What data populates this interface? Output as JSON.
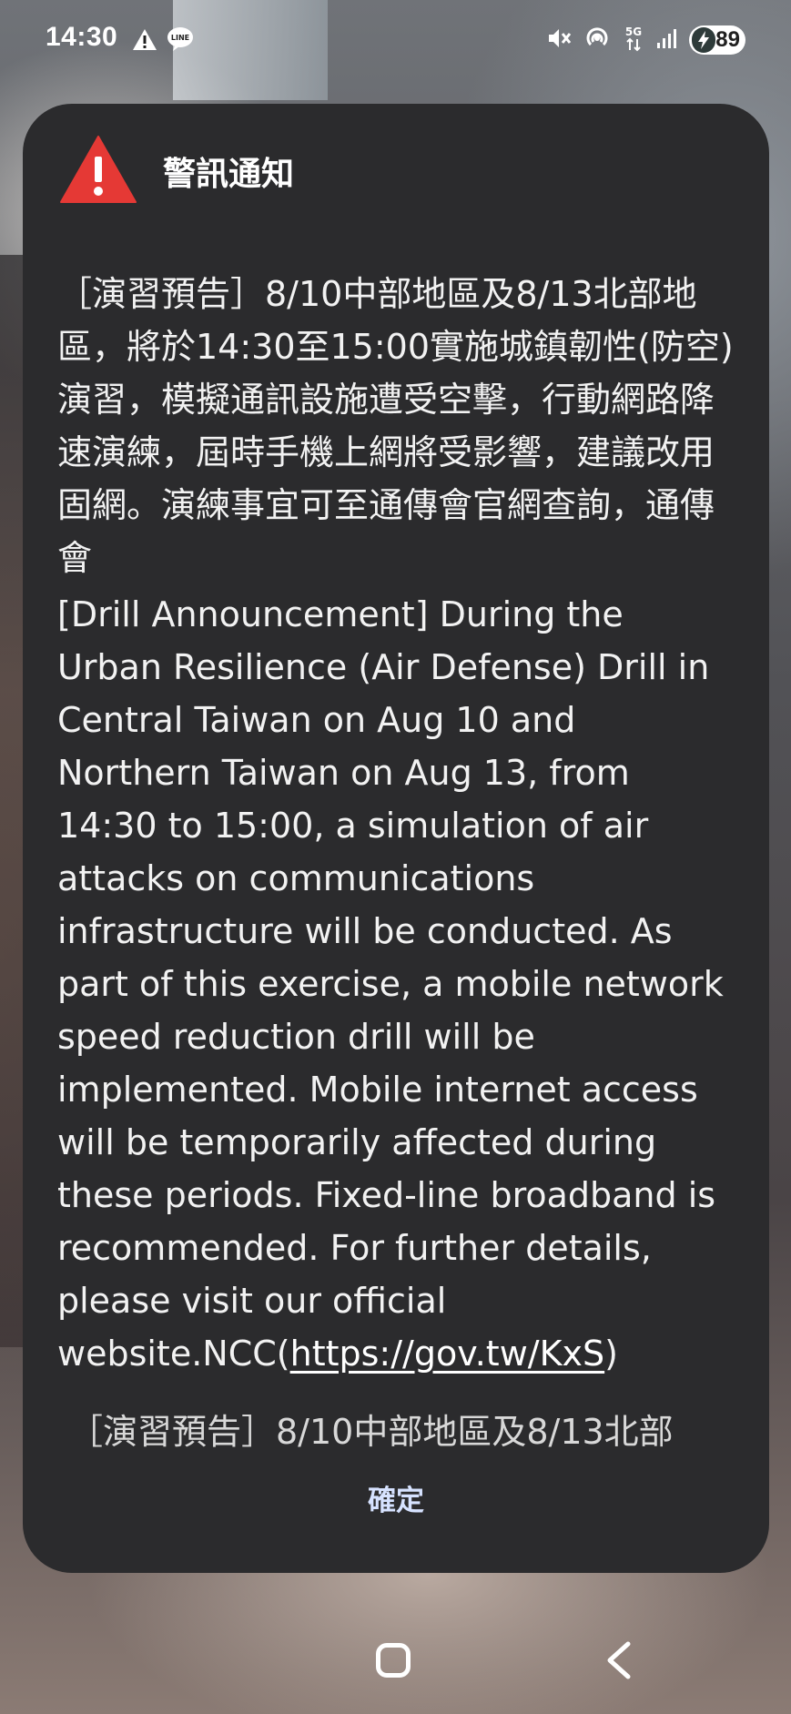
{
  "status_bar": {
    "time": "14:30",
    "left_icons": [
      "warning-icon",
      "line-app-icon"
    ],
    "right_icons": [
      "mute-vibrate-icon",
      "hotspot-icon",
      "5g-icon",
      "signal-icon"
    ],
    "network_label": "5G",
    "battery": "89"
  },
  "dialog": {
    "title": "警訊通知",
    "zh_message": "［演習預告］8/10中部地區及8/13北部地區，將於14:30至15:00實施城鎮韌性(防空)演習，模擬通訊設施遭受空擊，行動網路降速演練，屆時手機上網將受影響，建議改用固網。演練事宜可至通傳會官網查詢，通傳會",
    "en_message": "[Drill Announcement] During the Urban Resilience (Air Defense) Drill in Central Taiwan on Aug 10 and Northern Taiwan on Aug 13, from 14:30 to 15:00, a simulation of air attacks on communications infrastructure will be conducted. As part of this exercise, a mobile network speed reduction drill will be implemented. Mobile internet access will be temporarily affected during these periods. Fixed-line broadband is recommended. For further details, please visit our official website.NCC(",
    "link_text": "https://gov.tw/KxS",
    "en_suffix": ")",
    "preview": "［演習預告］8/10中部地區及8/13北部",
    "confirm_label": "確定"
  },
  "colors": {
    "dialog_background": "#2b2b2d",
    "warning_red": "#e53935",
    "confirm_text": "#d6e2ff"
  }
}
